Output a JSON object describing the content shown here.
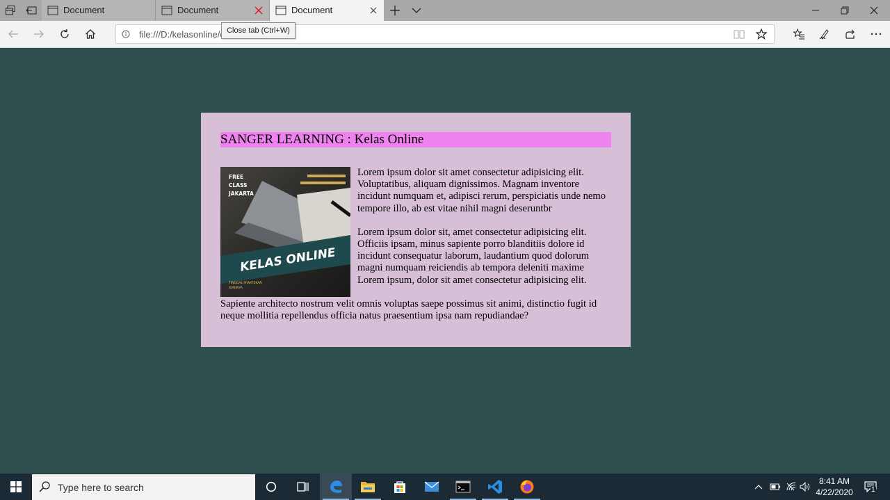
{
  "browser": {
    "tabs": [
      {
        "title": "Document"
      },
      {
        "title": "Document"
      },
      {
        "title": "Document"
      }
    ],
    "address": "file:///D:/kelasonline/d",
    "tooltip": "Close tab (Ctrl+W)"
  },
  "page": {
    "heading": "SANGER LEARNING : Kelas Online",
    "image": {
      "badge_lines": [
        "FREE",
        "CLASS",
        "JAKARTA"
      ],
      "banner": "KELAS ONLINE",
      "tagline_lines": [
        "TINGGAL PRAKTEKAN",
        "ILMUNYA"
      ],
      "accent": "#e7c25a"
    },
    "paragraphs": [
      "Lorem ipsum dolor sit amet consectetur adipisicing elit. Voluptatibus, aliquam dignissimos. Magnam inventore incidunt numquam et, adipisci rerum, perspiciatis unde nemo tempore illo, ab est vitae nihil magni deseruntbr",
      "Lorem ipsum dolor sit, amet consectetur adipisicing elit. Officiis ipsam, minus sapiente porro blanditiis dolore id incidunt consequatur laborum, laudantium quod dolorum magni numquam reiciendis ab tempora deleniti maxime Lorem ipsum, dolor sit amet consectetur adipisicing elit.",
      "Sapiente architecto nostrum velit omnis voluptas saepe possimus sit animi, distinctio fugit id neque mollitia repellendus officia natus praesentium ipsa nam repudiandae?"
    ],
    "colors": {
      "background": "#2f4f4f",
      "box": "#d8bfd8",
      "heading_bg": "#ee82ee"
    }
  },
  "taskbar": {
    "search_placeholder": "Type here to search",
    "time": "8:41 AM",
    "date": "4/22/2020",
    "notification_count": "1"
  }
}
